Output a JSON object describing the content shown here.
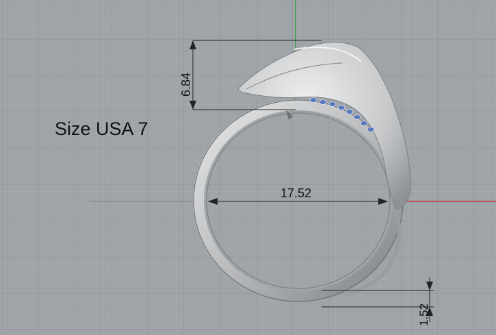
{
  "viewport": {
    "background": "#9ea4a8",
    "grid_minor_color": "#a9afb3",
    "grid_major_color": "#8d9397",
    "axis_y_color": "#2e9e3e",
    "axis_x_color": "#c83232"
  },
  "annotations": {
    "size_label": "Size USA 7",
    "ring_diameter": "17.52",
    "head_height": "6.84",
    "band_thickness": "1.52"
  },
  "model": {
    "name": "ring-model",
    "metal_color": "#c9cbcd",
    "stone_color": "#5a7ac0"
  }
}
